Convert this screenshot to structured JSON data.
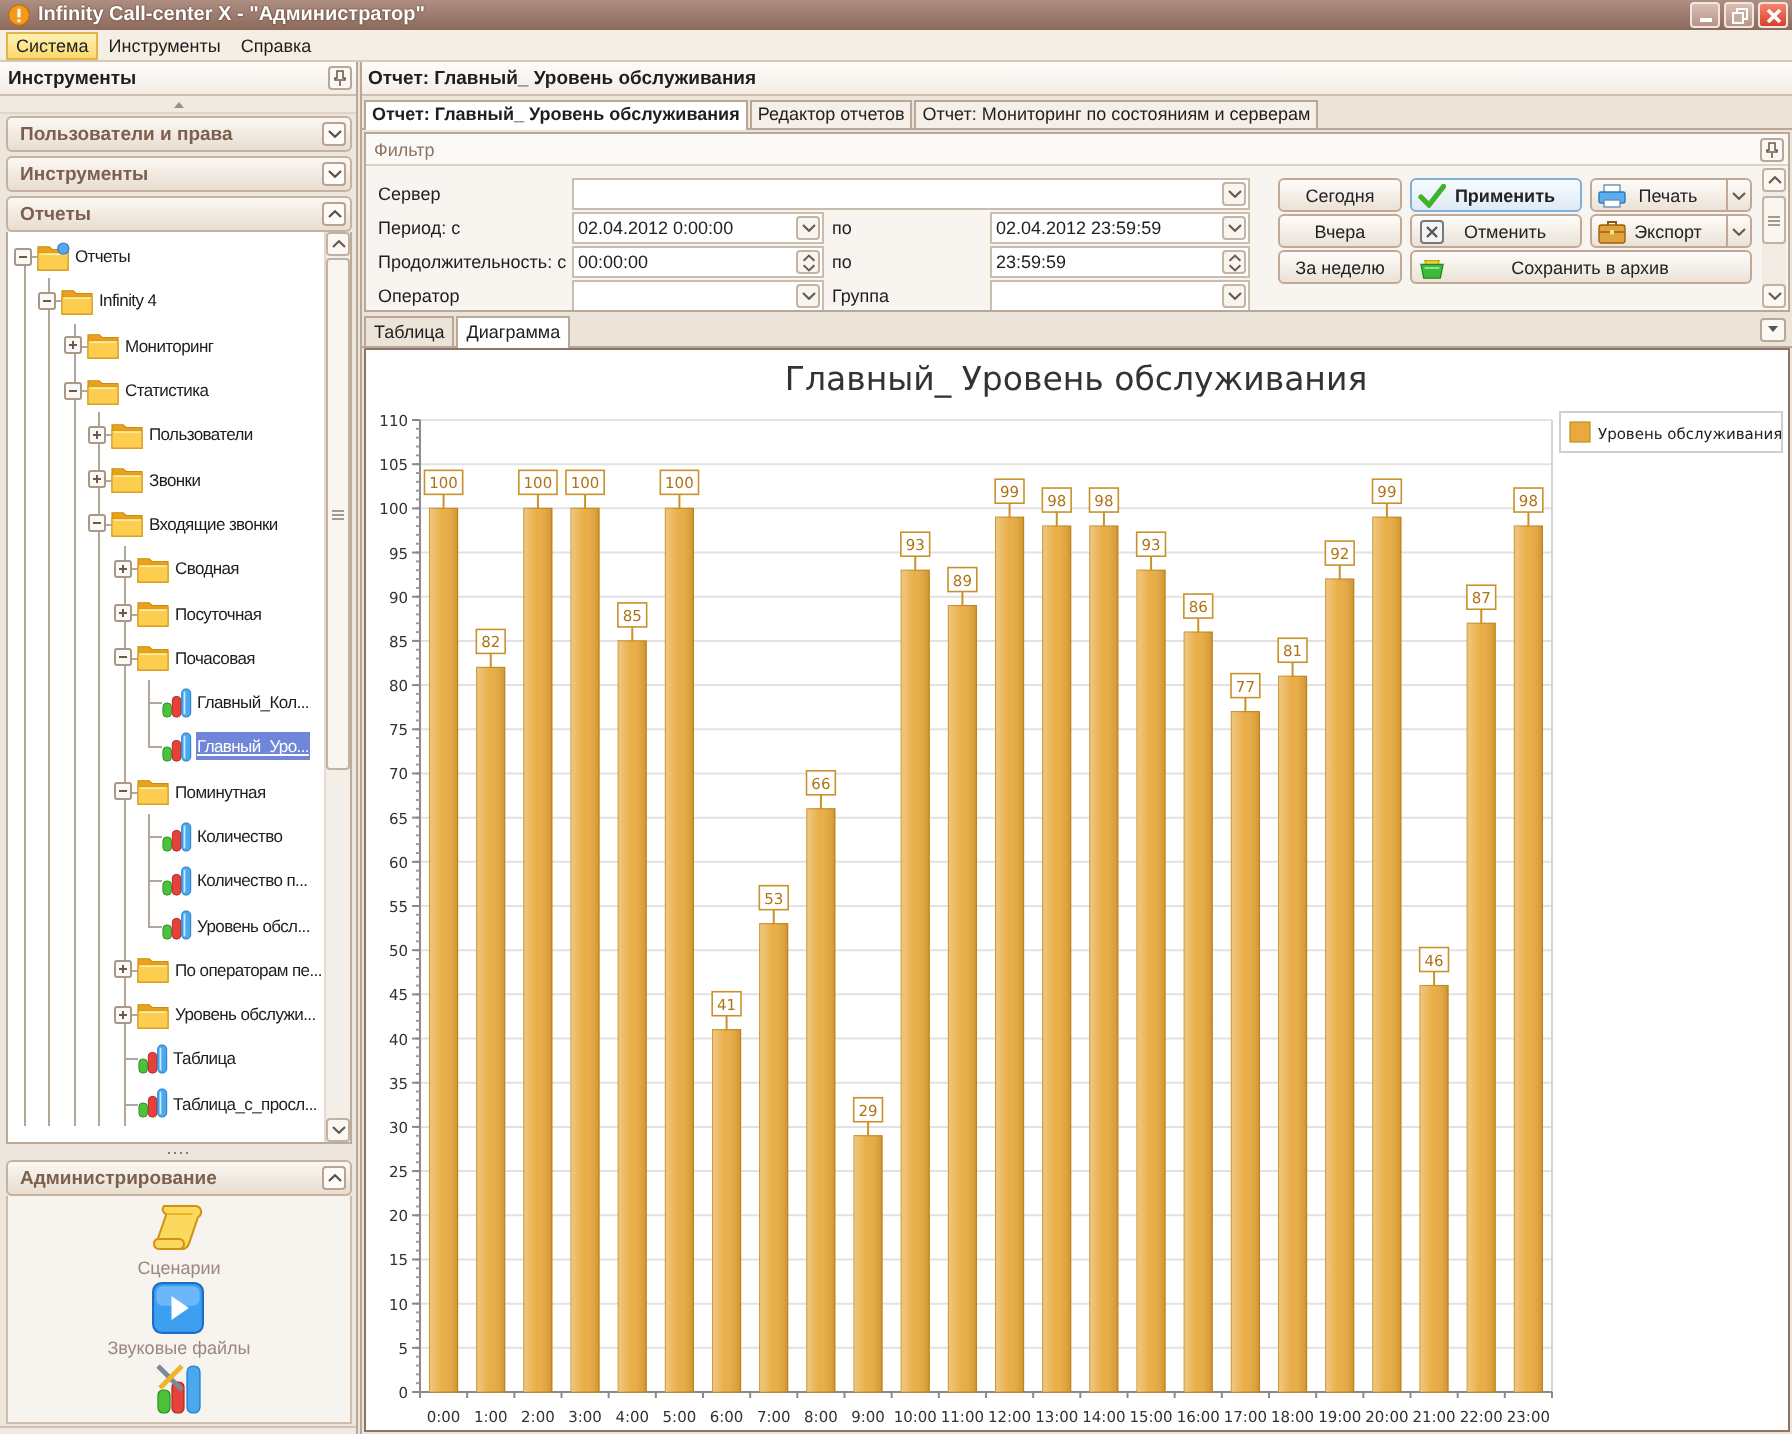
{
  "window": {
    "title": "Infinity Call-center X - \"Администратор\""
  },
  "menu": [
    {
      "label": "Система",
      "selected": true
    },
    {
      "label": "Инструменты",
      "selected": false
    },
    {
      "label": "Справка",
      "selected": false
    }
  ],
  "sidebar": {
    "title": "Инструменты",
    "groups": [
      {
        "label": "Пользователи и права",
        "expanded": false
      },
      {
        "label": "Инструменты",
        "expanded": false
      },
      {
        "label": "Отчеты",
        "expanded": true,
        "tree": [
          {
            "label": "Отчеты",
            "kind": "root",
            "expanded": true,
            "selected": false,
            "children": [
              {
                "label": "Infinity 4",
                "kind": "folder",
                "expanded": true,
                "selected": false,
                "children": [
                  {
                    "label": "Мониторинг",
                    "kind": "folder",
                    "expanded": false,
                    "selected": false
                  },
                  {
                    "label": "Статистика",
                    "kind": "folder",
                    "expanded": true,
                    "selected": false,
                    "children": [
                      {
                        "label": "Пользователи",
                        "kind": "folder",
                        "expanded": false,
                        "selected": false
                      },
                      {
                        "label": "Звонки",
                        "kind": "folder",
                        "expanded": false,
                        "selected": false
                      },
                      {
                        "label": "Входящие звонки",
                        "kind": "folder",
                        "expanded": true,
                        "selected": false,
                        "children": [
                          {
                            "label": "Сводная",
                            "kind": "folder",
                            "expanded": false,
                            "selected": false
                          },
                          {
                            "label": "Посуточная",
                            "kind": "folder",
                            "expanded": false,
                            "selected": false
                          },
                          {
                            "label": "Почасовая",
                            "kind": "folder",
                            "expanded": true,
                            "selected": false,
                            "children": [
                              {
                                "label": "Главный_Кол...",
                                "kind": "report",
                                "selected": false
                              },
                              {
                                "label": "Главный_Уро...",
                                "kind": "report",
                                "selected": true
                              }
                            ]
                          },
                          {
                            "label": "Поминутная",
                            "kind": "folder",
                            "expanded": true,
                            "selected": false,
                            "children": [
                              {
                                "label": "Количество",
                                "kind": "report",
                                "selected": false
                              },
                              {
                                "label": "Количество п...",
                                "kind": "report",
                                "selected": false
                              },
                              {
                                "label": "Уровень обсл...",
                                "kind": "report",
                                "selected": false
                              }
                            ]
                          },
                          {
                            "label": "По операторам пе...",
                            "kind": "folder",
                            "expanded": false,
                            "selected": false
                          },
                          {
                            "label": "Уровень обслужи...",
                            "kind": "folder",
                            "expanded": false,
                            "selected": false
                          },
                          {
                            "label": "Таблица",
                            "kind": "report",
                            "selected": false
                          },
                          {
                            "label": "Таблица_с_просл...",
                            "kind": "report",
                            "selected": false
                          }
                        ]
                      }
                    ]
                  }
                ]
              }
            ]
          }
        ]
      }
    ],
    "admin": {
      "title": "Администрирование",
      "expanded": true,
      "items": [
        {
          "kind": "scripts",
          "label": "Сценарии"
        },
        {
          "kind": "sounds",
          "label": "Звуковые файлы"
        },
        {
          "kind": "tools"
        }
      ]
    }
  },
  "report": {
    "title": "Отчет: Главный_ Уровень обслуживания",
    "tabs": [
      {
        "label": "Отчет: Главный_ Уровень обслуживания",
        "selected": true
      },
      {
        "label": "Редактор отчетов",
        "selected": false
      },
      {
        "label": "Отчет: Мониторинг по состояниям и серверам",
        "selected": false
      }
    ],
    "filter": {
      "title": "Фильтр",
      "rows": [
        {
          "label": "Сервер",
          "fields": [
            {
              "kind": "combo"
            }
          ]
        },
        {
          "label": "Период: с",
          "separator": "по",
          "fields": [
            {
              "kind": "date",
              "value": "02.04.2012 0:00:00"
            },
            {
              "kind": "date",
              "value": "02.04.2012 23:59:59"
            }
          ]
        },
        {
          "label": "Продолжительность: с",
          "separator": "по",
          "fields": [
            {
              "kind": "spin",
              "value": "00:00:00"
            },
            {
              "kind": "spin",
              "value": "23:59:59"
            }
          ]
        },
        {
          "label": "Оператор",
          "separator": "Группа",
          "fields": [
            {
              "kind": "combo"
            },
            {
              "kind": "combo"
            }
          ]
        }
      ],
      "period_buttons": [
        "Сегодня",
        "Вчера",
        "За неделю"
      ],
      "actions": [
        {
          "kind": "apply",
          "label": "Применить",
          "default": true
        },
        {
          "kind": "cancel",
          "label": "Отменить",
          "default": false
        },
        {
          "kind": "archive",
          "label": "Сохранить в архив",
          "default": false
        }
      ],
      "outputs": [
        {
          "kind": "print",
          "label": "Печать"
        },
        {
          "kind": "export",
          "label": "Экспорт"
        }
      ]
    },
    "view_tabs": [
      {
        "label": "Таблица",
        "selected": false
      },
      {
        "label": "Диаграмма",
        "selected": true
      }
    ],
    "chart_data": {
      "type": "bar",
      "title": "Главный_ Уровень обслуживания",
      "categories": [
        "0:00",
        "1:00",
        "2:00",
        "3:00",
        "4:00",
        "5:00",
        "6:00",
        "7:00",
        "8:00",
        "9:00",
        "10:00",
        "11:00",
        "12:00",
        "13:00",
        "14:00",
        "15:00",
        "16:00",
        "17:00",
        "18:00",
        "19:00",
        "20:00",
        "21:00",
        "22:00",
        "23:00"
      ],
      "series": [
        {
          "name": "Уровень обслуживания",
          "color": "#e8aa3e",
          "values": [
            100,
            82,
            100,
            100,
            85,
            100,
            41,
            53,
            66,
            29,
            93,
            89,
            99,
            98,
            98,
            93,
            86,
            77,
            81,
            92,
            99,
            46,
            87,
            98
          ]
        }
      ],
      "ylim": [
        0,
        110
      ],
      "yticks": [
        0,
        5,
        10,
        15,
        20,
        25,
        30,
        35,
        40,
        45,
        50,
        55,
        60,
        65,
        70,
        75,
        80,
        85,
        90,
        95,
        100,
        105,
        110
      ],
      "grid": true,
      "data_labels": true
    }
  }
}
